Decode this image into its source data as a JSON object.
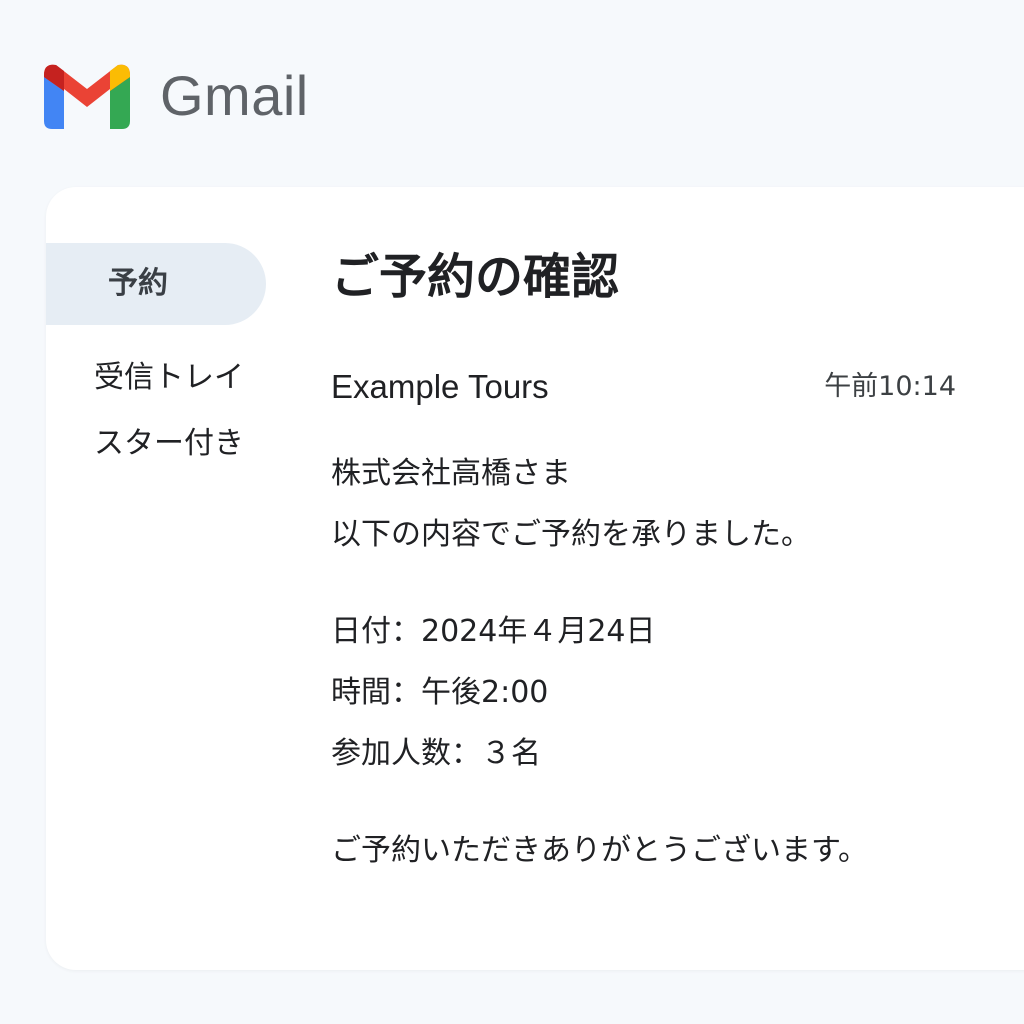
{
  "app": {
    "name": "Gmail",
    "logo_icon": "gmail-m-logo",
    "colors": {
      "red": "#ea4335",
      "blue": "#4285f4",
      "green": "#34a853",
      "yellow": "#fbbc04",
      "active_nav": "#e6edf4"
    }
  },
  "sidebar": {
    "items": [
      {
        "label": "予約",
        "active": true
      },
      {
        "label": "受信トレイ",
        "active": false
      },
      {
        "label": "スター付き",
        "active": false
      }
    ]
  },
  "email": {
    "subject": "ご予約の確認",
    "sender": "Example Tours",
    "time": "午前10:14",
    "greeting": "株式会社高橋さま",
    "intro": "以下の内容でご予約を承りました。",
    "date_line": "日付：2024年４月24日",
    "time_line": "時間：午後2:00",
    "people_line": "参加人数：３名",
    "closing": "ご予約いただきありがとうございます。"
  }
}
